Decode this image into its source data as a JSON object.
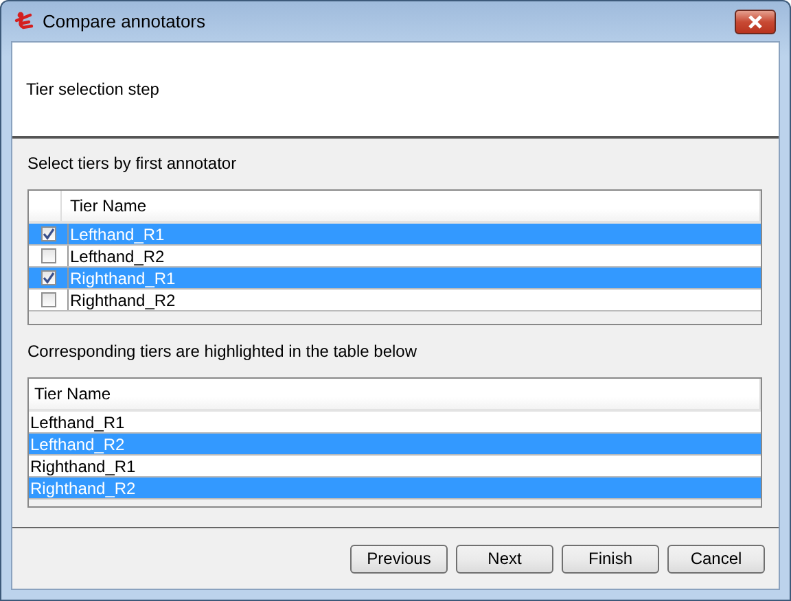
{
  "window": {
    "title": "Compare annotators"
  },
  "header": {
    "step": "Tier selection step"
  },
  "first_table": {
    "caption": "Select tiers by first annotator",
    "columns": [
      "Tier Name"
    ],
    "rows": [
      {
        "name": "Lefthand_R1",
        "checked": true,
        "selected": true
      },
      {
        "name": "Lefthand_R2",
        "checked": false,
        "selected": false
      },
      {
        "name": "Righthand_R1",
        "checked": true,
        "selected": true
      },
      {
        "name": "Righthand_R2",
        "checked": false,
        "selected": false
      }
    ]
  },
  "second_table": {
    "caption": "Corresponding tiers are highlighted in the table below",
    "columns": [
      "Tier Name"
    ],
    "rows": [
      {
        "name": "Lefthand_R1",
        "selected": false
      },
      {
        "name": "Lefthand_R2",
        "selected": true
      },
      {
        "name": "Righthand_R1",
        "selected": false
      },
      {
        "name": "Righthand_R2",
        "selected": true
      }
    ]
  },
  "buttons": [
    "Previous",
    "Next",
    "Finish",
    "Cancel"
  ]
}
